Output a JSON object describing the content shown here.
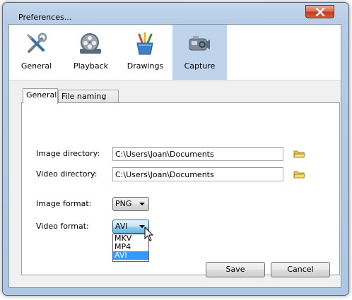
{
  "window": {
    "title": "Preferences..."
  },
  "toolbar": {
    "items": [
      {
        "label": "General",
        "icon": "tools-icon"
      },
      {
        "label": "Playback",
        "icon": "film-reel-icon"
      },
      {
        "label": "Drawings",
        "icon": "pencils-icon"
      },
      {
        "label": "Capture",
        "icon": "camera-icon",
        "active": true
      }
    ]
  },
  "tabs": [
    {
      "label": "General",
      "active": true
    },
    {
      "label": "File naming",
      "active": false
    }
  ],
  "fields": {
    "image_directory": {
      "label": "Image directory:",
      "value": "C:\\Users\\Joan\\Documents"
    },
    "video_directory": {
      "label": "Video directory:",
      "value": "C:\\Users\\Joan\\Documents"
    },
    "image_format": {
      "label": "Image format:",
      "value": "PNG"
    },
    "video_format": {
      "label": "Video format:",
      "value": "AVI",
      "options": [
        "MKV",
        "MP4",
        "AVI"
      ],
      "selected": "AVI"
    }
  },
  "buttons": {
    "save": "Save",
    "cancel": "Cancel"
  },
  "colors": {
    "selection": "#3399ff",
    "active_tool": "#bfd3ea",
    "close": "#c53b1f"
  }
}
